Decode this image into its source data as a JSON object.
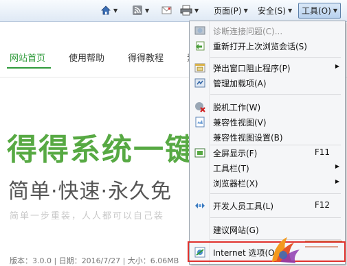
{
  "toolbar": {
    "home_icon": "home-icon",
    "rss_icon": "rss-icon",
    "mail_icon": "mail-icon",
    "print_icon": "print-icon",
    "page_label": "页面(P)",
    "safety_label": "安全(S)",
    "tools_label": "工具(O)"
  },
  "page": {
    "nav": [
      "网站首页",
      "使用帮助",
      "得得教程",
      "素"
    ],
    "headline": "得得系统一键",
    "subtitle": "简单·快速·永久免",
    "subtitle2": "简单一步重装，人人都可以自己装",
    "meta": "版本：3.0.0  |  日期：2016/7/27  |  大小：6.06MB"
  },
  "menu": {
    "items": [
      {
        "label": "诊断连接问题(C)...",
        "icon": "diagnose-icon",
        "disabled": true
      },
      {
        "label": "重新打开上次浏览会话(S)",
        "icon": "reopen-session-icon"
      },
      {
        "label": "弹出窗口阻止程序(P)",
        "icon": "popup-blocker-icon",
        "submenu": true
      },
      {
        "label": "管理加载项(A)",
        "icon": "addons-icon"
      },
      {
        "label": "脱机工作(W)",
        "icon": "offline-icon"
      },
      {
        "label": "兼容性视图(V)",
        "icon": "compat-view-icon"
      },
      {
        "label": "兼容性视图设置(B)",
        "icon": ""
      },
      {
        "label": "全屏显示(F)",
        "icon": "fullscreen-icon",
        "shortcut": "F11"
      },
      {
        "label": "工具栏(T)",
        "icon": "",
        "submenu": true
      },
      {
        "label": "浏览器栏(X)",
        "icon": "",
        "submenu": true
      },
      {
        "label": "开发人员工具(L)",
        "icon": "dev-tools-icon",
        "shortcut": "F12"
      },
      {
        "label": "建议网站(G)",
        "icon": ""
      },
      {
        "label": "Internet 选项(O)",
        "icon": "internet-options-icon"
      }
    ]
  },
  "colors": {
    "brand_green": "#57a943",
    "highlight_red": "#e0312d"
  }
}
